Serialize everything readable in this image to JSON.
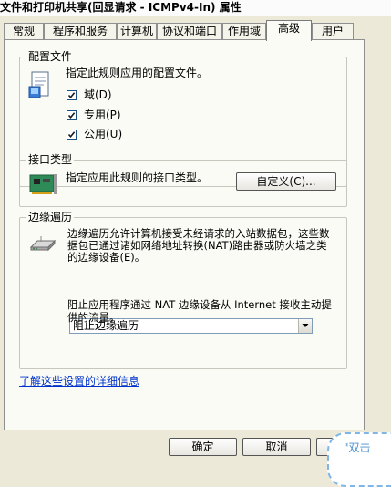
{
  "window": {
    "title": "文件和打印机共享(回显请求 - ICMPv4-In) 属性"
  },
  "tabs": [
    {
      "label": "常规"
    },
    {
      "label": "程序和服务"
    },
    {
      "label": "计算机"
    },
    {
      "label": "协议和端口"
    },
    {
      "label": "作用域"
    },
    {
      "label": "高级"
    },
    {
      "label": "用户"
    }
  ],
  "profiles": {
    "title": "配置文件",
    "description": "指定此规则应用的配置文件。",
    "options": [
      {
        "label": "域(D)",
        "checked": true
      },
      {
        "label": "专用(P)",
        "checked": true
      },
      {
        "label": "公用(U)",
        "checked": true
      }
    ]
  },
  "interface_types": {
    "title": "接口类型",
    "description": "指定应用此规则的接口类型。",
    "button": "自定义(C)..."
  },
  "edge_traversal": {
    "title": "边缘遍历",
    "description": "边缘遍历允许计算机接受未经请求的入站数据包，这些数据包已通过诸如网络地址转换(NAT)路由器或防火墙之类的边缘设备(E)。",
    "selected": "阻止边缘遍历",
    "detail": "阻止应用程序通过 NAT 边缘设备从 Internet 接收主动提供的流量。"
  },
  "link": "了解这些设置的详细信息",
  "buttons": {
    "ok": "确定",
    "cancel": "取消"
  },
  "overlay": {
    "text": "\"双击"
  },
  "colors": {
    "link": "#0033cc",
    "panel_bg": "#fbfbf6",
    "dialog_bg": "#ece9d8"
  }
}
